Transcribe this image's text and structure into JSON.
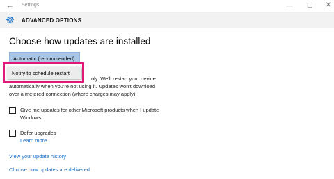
{
  "window": {
    "back_glyph": "←",
    "title": "Settings",
    "minimize_glyph": "—",
    "maximize_glyph": "☐",
    "close_glyph": "✕"
  },
  "header": {
    "icon": "gear-icon",
    "title": "ADVANCED OPTIONS"
  },
  "main": {
    "title": "Choose how updates are installed",
    "select": {
      "selected": "Automatic (recommended)",
      "options_visible": [
        "Notify to schedule restart"
      ]
    },
    "description_lines": [
      "nly. We'll restart your device",
      "automatically when you're not using it. Updates won't download",
      "over a metered connection (where charges may apply)."
    ],
    "checkboxes": [
      {
        "label_lines": [
          "Give me updates for other Microsoft products when I update",
          "Windows."
        ],
        "checked": false
      },
      {
        "label_lines": [
          "Defer upgrades"
        ],
        "checked": false
      }
    ],
    "learn_more": "Learn more",
    "links": {
      "history": "View your update history",
      "delivered": "Choose how updates are delivered"
    }
  },
  "colors": {
    "accent": "#1a73c8",
    "select_bg": "#a8c7e6",
    "highlight": "#e0197a",
    "link": "#1a6fc4"
  }
}
